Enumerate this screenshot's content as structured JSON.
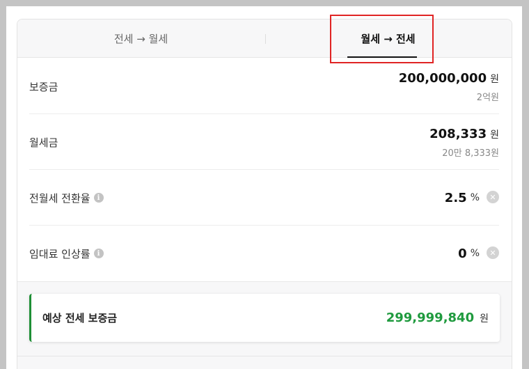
{
  "tabs": {
    "left_label": "전세 → 월세",
    "right_label": "월세 → 전세"
  },
  "rows": {
    "deposit": {
      "label": "보증금",
      "value": "200,000,000",
      "unit": "원",
      "sub": "2억원"
    },
    "monthly_rent": {
      "label": "월세금",
      "value": "208,333",
      "unit": "원",
      "sub": "20만 8,333원"
    },
    "conversion_rate": {
      "label": "전월세 전환율",
      "value": "2.5",
      "unit": "%"
    },
    "rent_increase": {
      "label": "임대료 인상률",
      "value": "0",
      "unit": "%"
    }
  },
  "result": {
    "label": "예상 전세 보증금",
    "value": "299,999,840",
    "unit": "원"
  },
  "colors": {
    "accent_green": "#1f9a3e",
    "highlight_red": "#e02424"
  }
}
